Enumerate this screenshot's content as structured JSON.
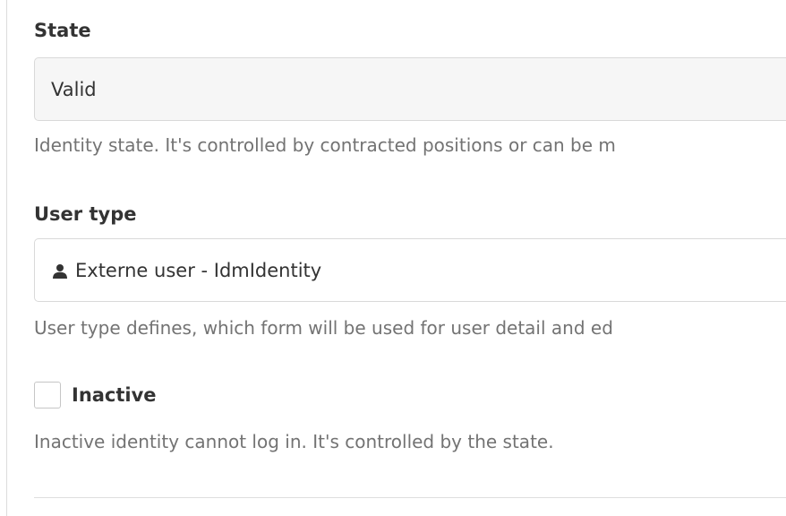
{
  "state": {
    "label": "State",
    "value": "Valid",
    "help": "Identity state. It's controlled by contracted positions or can be m"
  },
  "user_type": {
    "label": "User type",
    "value": "Externe user - IdmIdentity",
    "icon": "user-icon",
    "help": "User type defines, which form will be used for user detail and ed"
  },
  "inactive": {
    "label": "Inactive",
    "checked": false,
    "help": "Inactive identity cannot log in. It's controlled by the state."
  }
}
